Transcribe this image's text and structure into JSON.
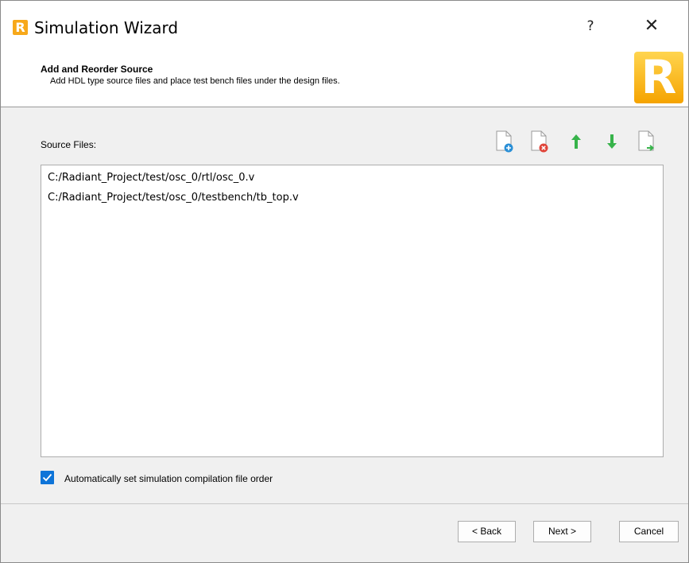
{
  "window": {
    "title": "Simulation Wizard",
    "help_label": "?",
    "close_label": "✕",
    "logo_letter": "R"
  },
  "header": {
    "title": "Add and Reorder Source",
    "subtitle": "Add HDL type source files and place test bench files under the design files.",
    "brand_letter": "R"
  },
  "source_files": {
    "label": "Source Files:",
    "toolbar": [
      "add-file-icon",
      "remove-file-icon",
      "move-up-icon",
      "move-down-icon",
      "export-file-icon"
    ],
    "items": [
      "C:/Radiant_Project/test/osc_0/rtl/osc_0.v",
      "C:/Radiant_Project/test/osc_0/testbench/tb_top.v"
    ]
  },
  "options": {
    "auto_order_label": "Automatically set simulation compilation file order",
    "auto_order_checked": true
  },
  "buttons": {
    "back": "< Back",
    "next": "Next >",
    "cancel": "Cancel"
  },
  "colors": {
    "accent": "#0e74d8",
    "logo": "#f7a81a",
    "arrow_green": "#37b34a",
    "add_blue": "#2a8fd6",
    "remove_red": "#e0453a"
  }
}
